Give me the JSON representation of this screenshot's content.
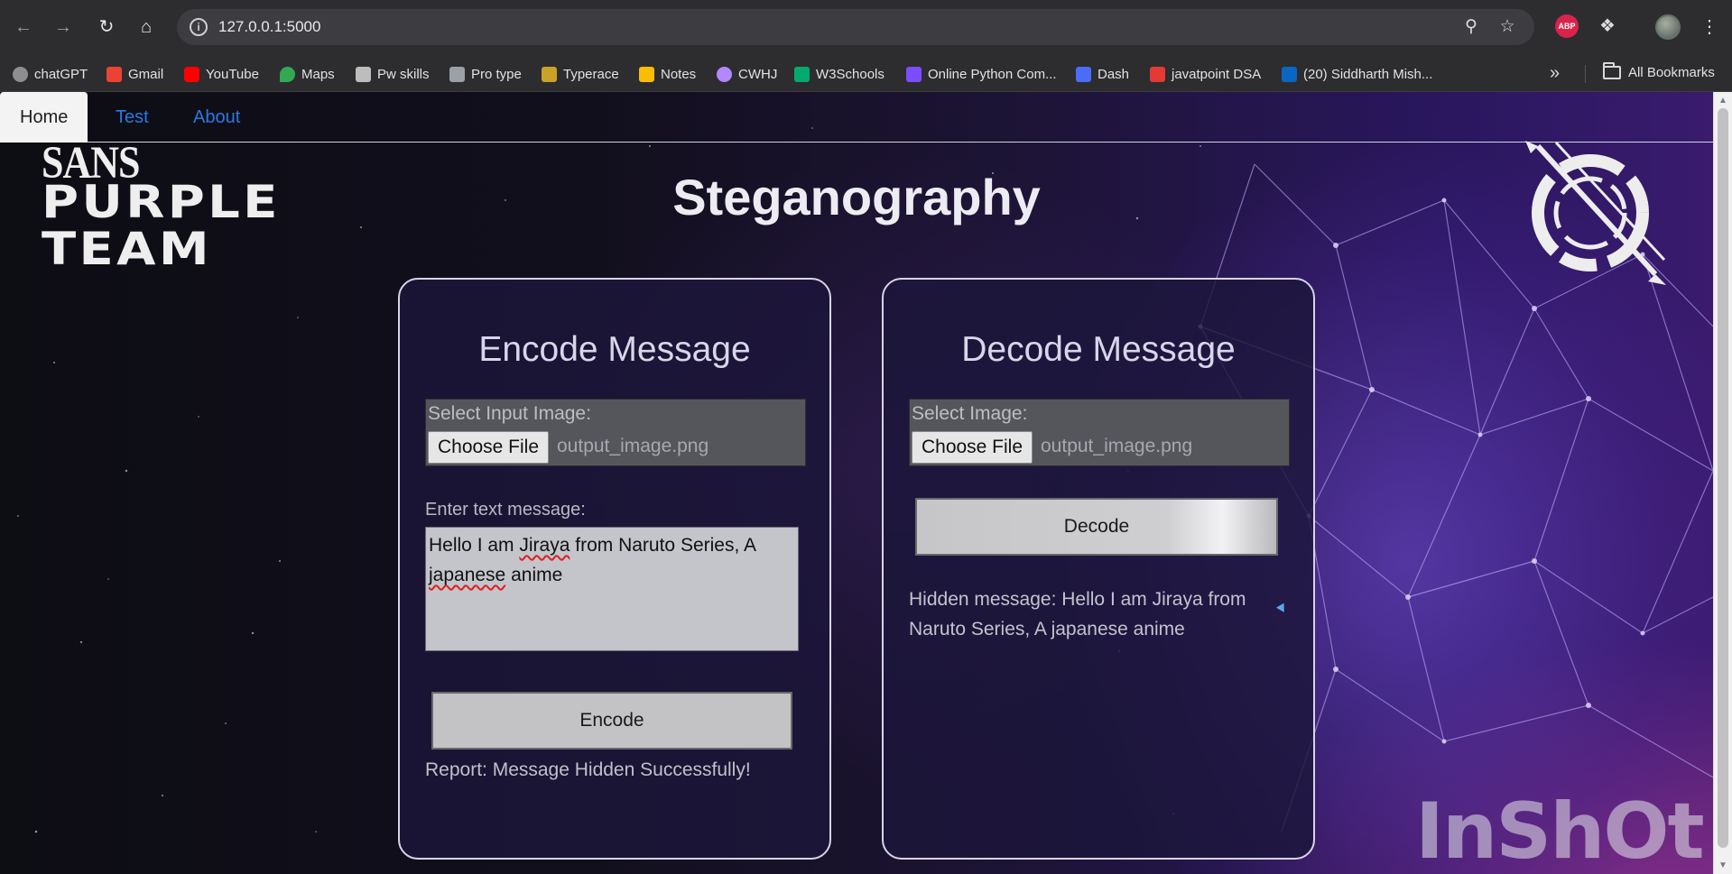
{
  "browser": {
    "url": "127.0.0.1:5000",
    "extension_abp": "ABP",
    "bookmarks": [
      {
        "label": "chatGPT",
        "icon": "chatgpt-icon",
        "color": "#8e8e8e"
      },
      {
        "label": "Gmail",
        "icon": "gmail-icon",
        "color": "#ea4335"
      },
      {
        "label": "YouTube",
        "icon": "youtube-icon",
        "color": "#ff0000"
      },
      {
        "label": "Maps",
        "icon": "maps-icon",
        "color": "#34a853"
      },
      {
        "label": "Pw skills",
        "icon": "pwskills-icon",
        "color": "#bdbdbd"
      },
      {
        "label": "Pro type",
        "icon": "protype-icon",
        "color": "#9aa0a6"
      },
      {
        "label": "Typerace",
        "icon": "typerace-icon",
        "color": "#c9a227"
      },
      {
        "label": "Notes",
        "icon": "notes-icon",
        "color": "#fbbc04"
      },
      {
        "label": "CWHJ",
        "icon": "cwhj-icon",
        "color": "#b388ff"
      },
      {
        "label": "W3Schools",
        "icon": "w3schools-icon",
        "color": "#04aa6d"
      },
      {
        "label": "Online Python Com...",
        "icon": "python-compiler-icon",
        "color": "#7c4dff"
      },
      {
        "label": "Dash",
        "icon": "dash-icon",
        "color": "#4a6cf7"
      },
      {
        "label": "javatpoint DSA",
        "icon": "javatpoint-icon",
        "color": "#e53935"
      },
      {
        "label": "(20) Siddharth Mish...",
        "icon": "linkedin-icon",
        "color": "#0a66c2"
      }
    ],
    "all_bookmarks": "All Bookmarks"
  },
  "nav": {
    "home": "Home",
    "test": "Test",
    "about": "About"
  },
  "logo": {
    "line1": "SANS",
    "line2": "PURPLE",
    "line3": "TEAM"
  },
  "page": {
    "title": "Steganography"
  },
  "encode": {
    "heading": "Encode Message",
    "file_label": "Select Input Image:",
    "choose_file": "Choose File",
    "file_name": "output_image.png",
    "text_label": "Enter text message:",
    "text_value_part1": "Hello I am ",
    "text_value_word1": "Jiraya",
    "text_value_part2": " from Naruto Series, A ",
    "text_value_word2": "japanese",
    "text_value_part3": " anime",
    "button": "Encode",
    "report": "Report: Message Hidden Successfully!"
  },
  "decode": {
    "heading": "Decode Message",
    "file_label": "Select Image:",
    "choose_file": "Choose File",
    "file_name": "output_image.png",
    "button": "Decode",
    "result": "Hidden message: Hello I am Jiraya from Naruto Series, A japanese anime"
  },
  "watermark": "InShOt"
}
